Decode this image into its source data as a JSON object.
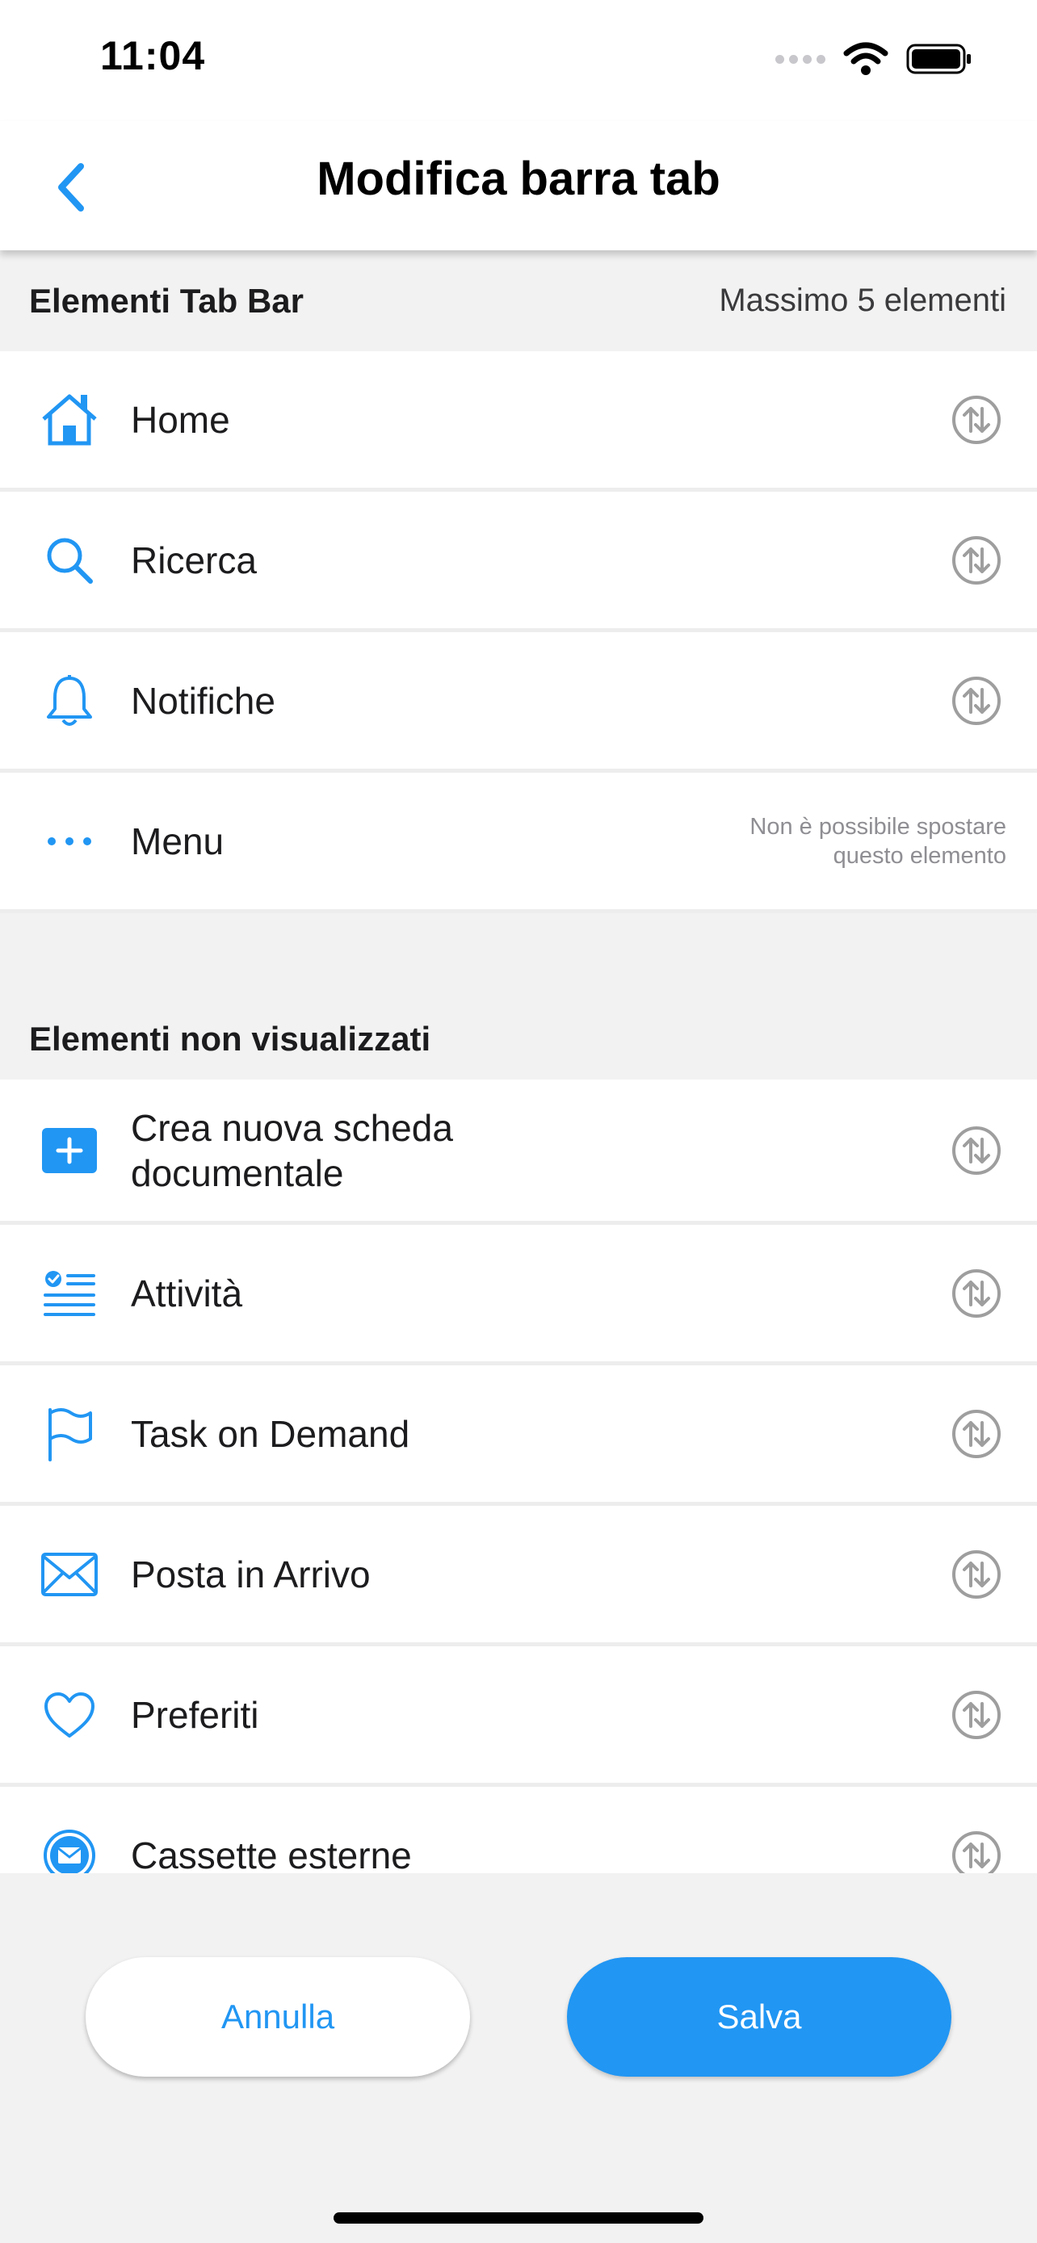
{
  "status_bar": {
    "time": "11:04"
  },
  "nav": {
    "title": "Modifica barra tab",
    "back_icon": "chevron-left-icon"
  },
  "sections": {
    "visible": {
      "title": "Elementi Tab Bar",
      "note": "Massimo 5 elementi",
      "items": [
        {
          "label": "Home",
          "icon": "home-icon"
        },
        {
          "label": "Ricerca",
          "icon": "search-icon"
        },
        {
          "label": "Notifiche",
          "icon": "bell-icon"
        },
        {
          "label": "Menu",
          "icon": "more-dots-icon",
          "locked_note_1": "Non è possibile spostare",
          "locked_note_2": "questo elemento"
        }
      ]
    },
    "hidden": {
      "title": "Elementi non visualizzati",
      "items": [
        {
          "label": "Crea nuova scheda documentale",
          "icon": "add-box-icon"
        },
        {
          "label": "Attività",
          "icon": "task-list-icon"
        },
        {
          "label": "Task on Demand",
          "icon": "flag-icon"
        },
        {
          "label": "Posta in Arrivo",
          "icon": "mail-icon"
        },
        {
          "label": "Preferiti",
          "icon": "heart-icon"
        },
        {
          "label": "Cassette esterne",
          "icon": "mail-circle-icon"
        }
      ]
    }
  },
  "actions": {
    "cancel_label": "Annulla",
    "save_label": "Salva"
  },
  "colors": {
    "accent": "#2196f3",
    "background": "#f2f2f2",
    "move_icon": "#9e9e9e"
  }
}
